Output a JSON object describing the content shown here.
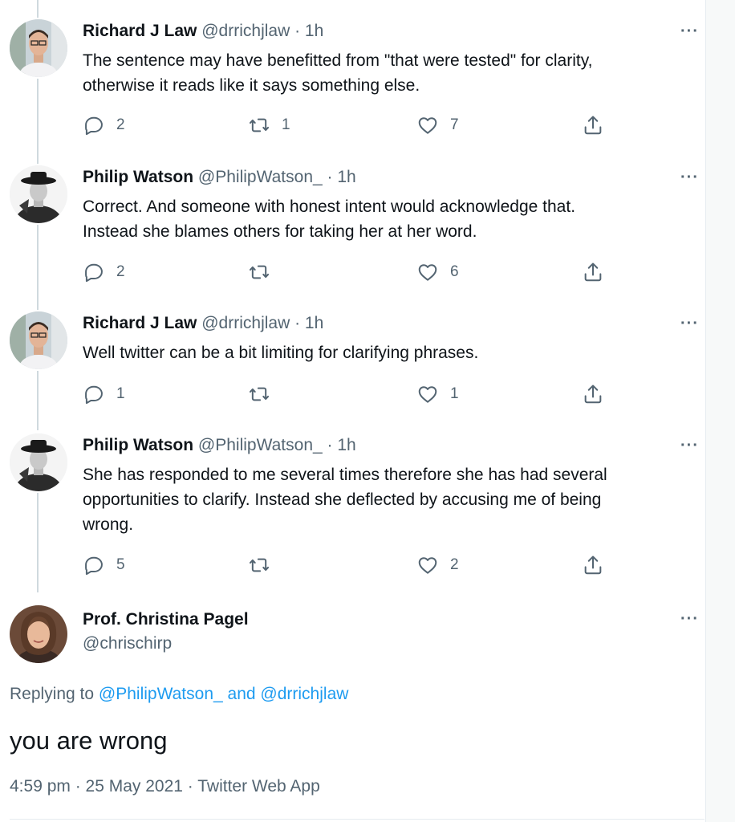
{
  "replies": [
    {
      "name": "Richard J Law",
      "meta": "@drrichjlaw · 1h",
      "avatar_icon": "man-portrait-glasses",
      "text": [
        "The sentence may have benefitted from \"that were tested\" for clarity,",
        "otherwise it reads like it says something else."
      ],
      "reply_count": "2",
      "retweet_count": "1",
      "like_count": "7"
    },
    {
      "name": "Philip Watson",
      "meta": "@PhilipWatson_ · 1h",
      "avatar_icon": "man-with-hat-bw",
      "text": [
        "Correct. And someone with honest intent would acknowledge that.",
        "Instead she blames others for taking her at her word."
      ],
      "reply_count": "2",
      "retweet_count": "",
      "like_count": "6"
    },
    {
      "name": "Richard J Law",
      "meta": "@drrichjlaw · 1h",
      "avatar_icon": "man-portrait-glasses",
      "text": [
        "Well twitter can be a bit limiting for clarifying phrases."
      ],
      "reply_count": "1",
      "retweet_count": "",
      "like_count": "1"
    },
    {
      "name": "Philip Watson",
      "meta": "@PhilipWatson_ · 1h",
      "avatar_icon": "man-with-hat-bw",
      "text": [
        "She has responded to me several times therefore she has had several",
        "opportunities to clarify. Instead she deflected by accusing me of being",
        "wrong."
      ],
      "reply_count": "5",
      "retweet_count": "",
      "like_count": "2"
    }
  ],
  "main": {
    "name": "Prof. Christina Pagel",
    "handle": "@chrischirp",
    "avatar_icon": "woman-portrait",
    "replying_prefix": "Replying to ",
    "replying_user1": "@PhilipWatson_",
    "replying_and": " and ",
    "replying_user2": "@drrichjlaw",
    "text": "you are wrong",
    "timestamp": "4:59 pm · 25 May 2021 · Twitter Web App"
  },
  "more_label": "···",
  "colors": {
    "text": "#0f1419",
    "secondary": "#536471",
    "link": "#1d9bf0",
    "thread_line": "#cfd9de"
  }
}
